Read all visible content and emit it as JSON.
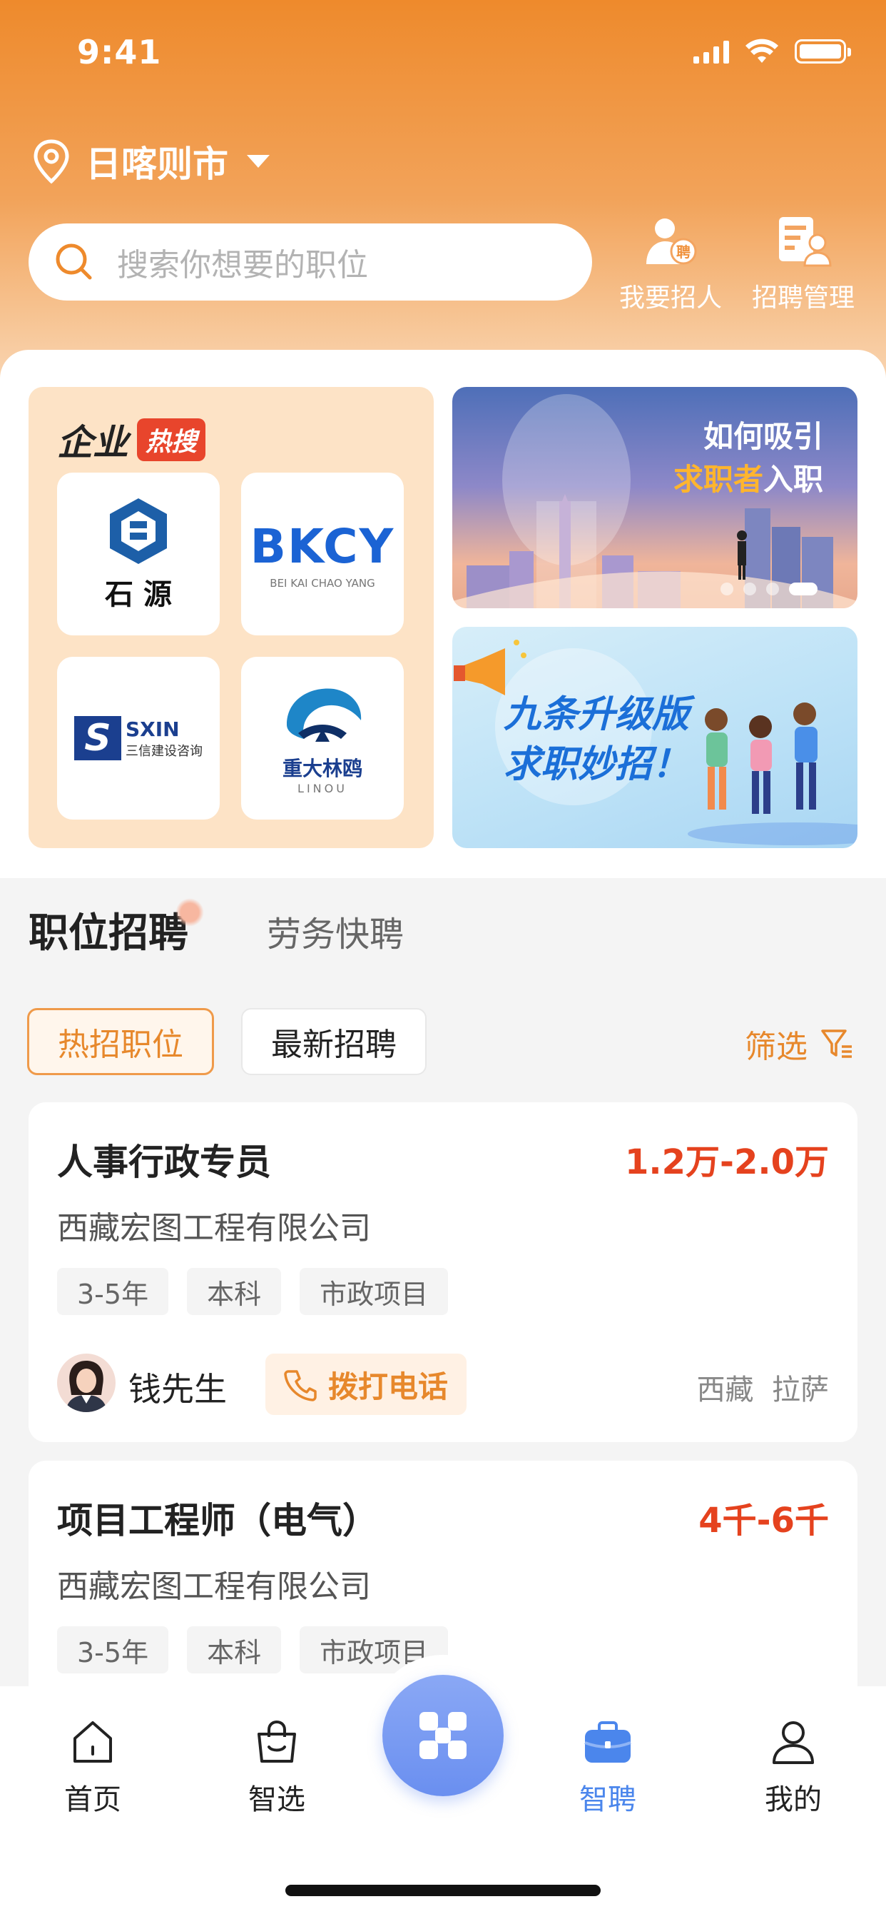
{
  "status": {
    "time": "9:41"
  },
  "header": {
    "city": "日喀则市",
    "search_placeholder": "搜索你想要的职位",
    "actions": [
      {
        "label": "我要招人",
        "badge": "聘"
      },
      {
        "label": "招聘管理"
      }
    ]
  },
  "hot_companies": {
    "title": "企业",
    "badge": "热搜",
    "logos": [
      {
        "text": "石 源"
      },
      {
        "text": "BKCY",
        "sub": "BEI KAI CHAO YANG"
      },
      {
        "text": "SXIN",
        "sub": "三信建设咨询"
      },
      {
        "text": "重大林鸥",
        "sub": "LINOU"
      }
    ]
  },
  "banners": [
    {
      "line1": "如何吸引",
      "line2_highlight": "求职者",
      "line2_rest": "入职"
    },
    {
      "line1": "九条升级版",
      "line2": "求职妙招！"
    }
  ],
  "tabs": {
    "main": "职位招聘",
    "secondary": "劳务快聘"
  },
  "chips": [
    "热招职位",
    "最新招聘"
  ],
  "filter_label": "筛选",
  "jobs": [
    {
      "title": "人事行政专员",
      "salary": "1.2万-2.0万",
      "company": "西藏宏图工程有限公司",
      "tags": [
        "3-5年",
        "本科",
        "市政项目"
      ],
      "contact": "钱先生",
      "call_label": "拨打电话",
      "location": "西藏  拉萨"
    },
    {
      "title": "项目工程师（电气）",
      "salary": "4千-6千",
      "company": "西藏宏图工程有限公司",
      "tags": [
        "3-5年",
        "本科",
        "市政项目"
      ]
    }
  ],
  "nav": [
    {
      "label": "首页",
      "icon": "home-icon"
    },
    {
      "label": "智选",
      "icon": "shopping-bag-icon"
    },
    {
      "label": "",
      "icon": "app-grid-icon"
    },
    {
      "label": "智聘",
      "icon": "briefcase-icon",
      "active": true
    },
    {
      "label": "我的",
      "icon": "user-icon"
    }
  ],
  "colors": {
    "accent": "#e7882c",
    "salary": "#e5421e",
    "nav_active": "#4b86ec"
  }
}
